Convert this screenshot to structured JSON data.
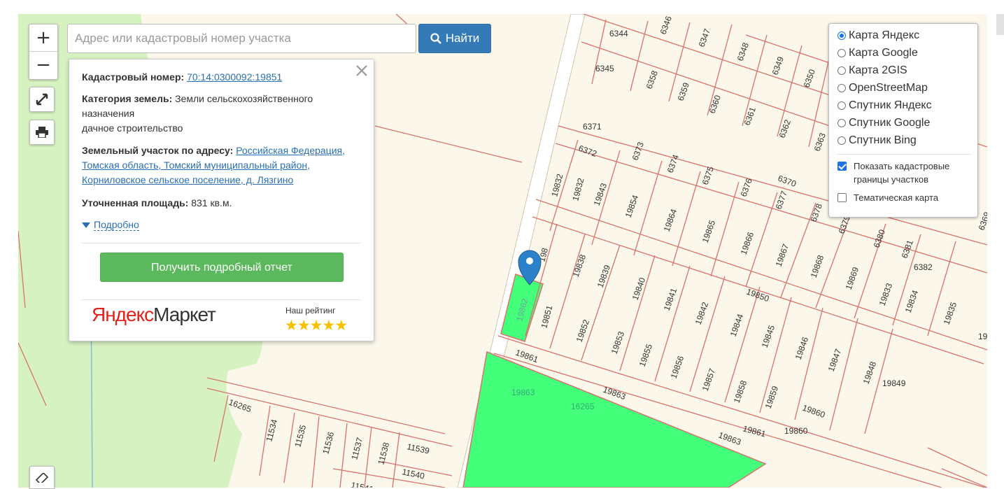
{
  "search": {
    "placeholder": "Адрес или кадастровый номер участка",
    "button_label": "Найти"
  },
  "zoom": {
    "in_label": "+",
    "out_label": "−"
  },
  "popup": {
    "cadastral_label": "Кадастровый номер:",
    "cadastral_number": "70:14:0300092:19851",
    "category_label": "Категория земель:",
    "category_value": "Земли сельскохозяйственного назначения",
    "category_use": "дачное строительство",
    "address_label": "Земельный участок по адресу:",
    "address_value": "Российская Федерация, Томская область, Томский муниципальный район, Корниловское сельское поселение, д. Лязгино",
    "area_label": "Уточненная площадь:",
    "area_value": "831 кв.м.",
    "more_label": "Подробно",
    "report_button": "Получить подробный отчет",
    "market_logo_yandex": "Яндекс",
    "market_logo_market": "Маркет",
    "rating_label": "Наш рейтинг",
    "rating_stars": "★★★★★"
  },
  "layers": {
    "base_maps": [
      {
        "label": "Карта Яндекс",
        "selected": true
      },
      {
        "label": "Карта Google",
        "selected": false
      },
      {
        "label": "Карта 2GIS",
        "selected": false
      },
      {
        "label": "OpenStreetMap",
        "selected": false
      },
      {
        "label": "Спутник Яндекс",
        "selected": false
      },
      {
        "label": "Спутник Google",
        "selected": false
      },
      {
        "label": "Спутник Bing",
        "selected": false
      }
    ],
    "overlays": [
      {
        "label": "Показать кадастровые границы участков",
        "checked": true
      },
      {
        "label": "Тематическая карта",
        "checked": false
      }
    ]
  },
  "parcel_labels": [
    "6344",
    "6345",
    "6346",
    "6347",
    "6348",
    "6349",
    "6350",
    "6351",
    "6358",
    "6359",
    "6360",
    "6361",
    "6362",
    "6363",
    "6371",
    "6372",
    "6373",
    "6374",
    "6375",
    "6376",
    "6377",
    "6378",
    "6379",
    "6380",
    "6381",
    "6382",
    "6370",
    "6369",
    "19832",
    "19832",
    "19843",
    "19854",
    "19864",
    "19865",
    "19866",
    "19867",
    "19868",
    "19869",
    "19833",
    "19834",
    "19835",
    "19836",
    "198",
    "19838",
    "19839",
    "19840",
    "19841",
    "19842",
    "19844",
    "19845",
    "19846",
    "19847",
    "19848",
    "19849",
    "19850",
    "19862",
    "19851",
    "19852",
    "19853",
    "19855",
    "19856",
    "19857",
    "19858",
    "19859",
    "19860",
    "19861",
    "19860",
    "19861",
    "19863",
    "19863",
    "19863",
    "16265",
    "16265",
    "11534",
    "11535",
    "11536",
    "11537",
    "11538",
    "11539",
    "11540",
    "11541",
    "1154"
  ],
  "colors": {
    "map_background": "#fbf7ea",
    "parcel_border": "#d8726d",
    "selected_parcel": "#44ff7a",
    "forest": "#d7f2c1",
    "primary_button": "#337ab7",
    "report_button": "#5cb85c",
    "link": "#2a6fb3",
    "marker": "#2b82cb"
  }
}
